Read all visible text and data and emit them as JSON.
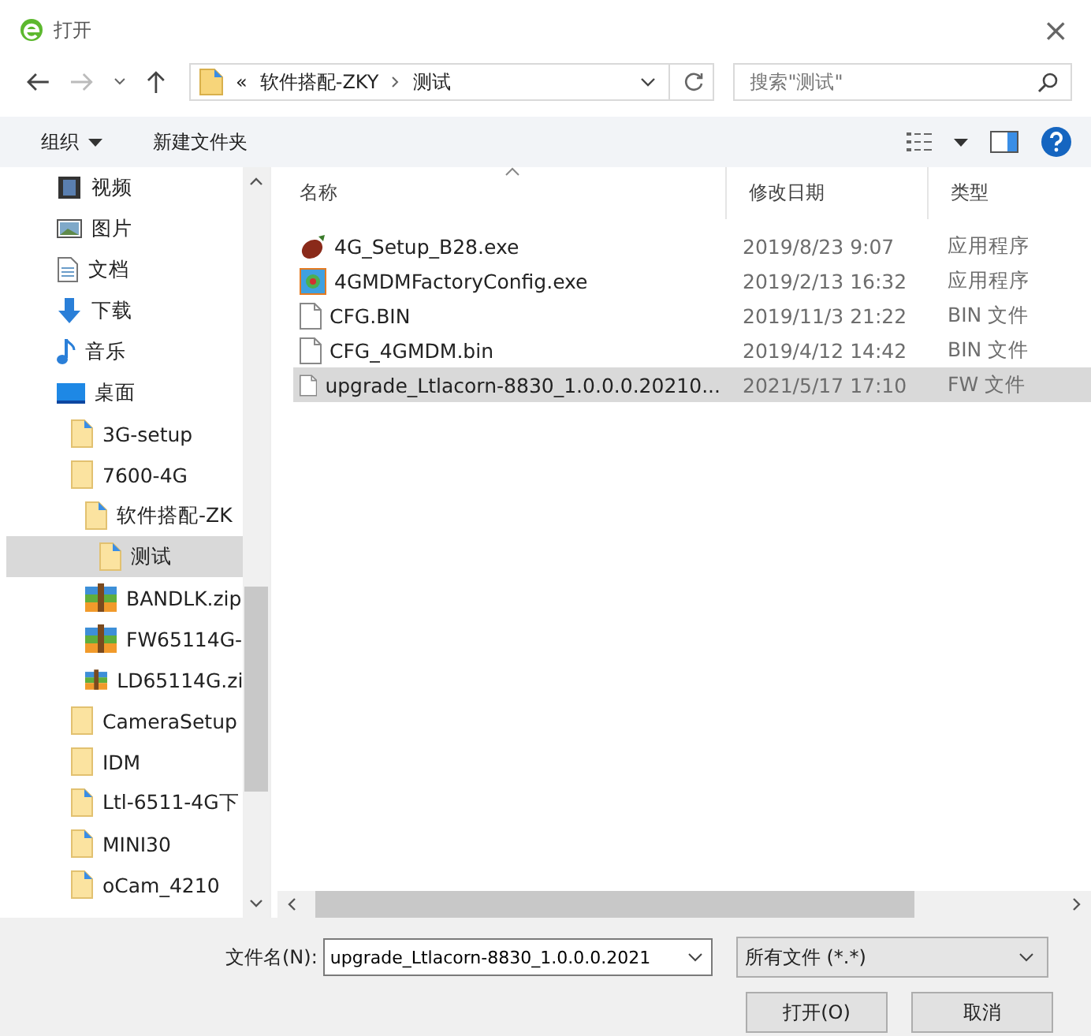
{
  "window": {
    "title": "打开",
    "close": "×"
  },
  "nav": {
    "path": [
      "软件搭配-ZKY",
      "测试"
    ],
    "overflow": "«",
    "search_placeholder": "搜索\"测试\""
  },
  "toolbar": {
    "organize": "组织",
    "new_folder": "新建文件夹"
  },
  "sidebar": {
    "items": [
      {
        "label": "视频",
        "kind": "video",
        "selected": false
      },
      {
        "label": "图片",
        "kind": "picture",
        "selected": false
      },
      {
        "label": "文档",
        "kind": "document",
        "selected": false
      },
      {
        "label": "下载",
        "kind": "download",
        "selected": false
      },
      {
        "label": "音乐",
        "kind": "music",
        "selected": false
      },
      {
        "label": "桌面",
        "kind": "desktop",
        "selected": false,
        "children": [
          {
            "label": "3G-setup",
            "kind": "shortcut",
            "selected": false
          },
          {
            "label": "7600-4G",
            "kind": "folder",
            "selected": false,
            "children": [
              {
                "label": "软件搭配-ZK",
                "kind": "shortcut",
                "selected": false,
                "children": [
                  {
                    "label": "测试",
                    "kind": "shortcut",
                    "selected": true
                  }
                ]
              },
              {
                "label": "BANDLK.zip",
                "kind": "zip",
                "selected": false
              },
              {
                "label": "FW65114G-",
                "kind": "zip",
                "selected": false
              },
              {
                "label": "LD65114G.zi",
                "kind": "zip",
                "selected": false
              }
            ]
          },
          {
            "label": "CameraSetup",
            "kind": "folder",
            "selected": false
          },
          {
            "label": "IDM",
            "kind": "folder",
            "selected": false
          },
          {
            "label": "Ltl-6511-4G下",
            "kind": "shortcut",
            "selected": false
          },
          {
            "label": "MINI30",
            "kind": "shortcut",
            "selected": false
          },
          {
            "label": "oCam_4210",
            "kind": "shortcut",
            "selected": false
          }
        ]
      }
    ]
  },
  "table": {
    "columns": [
      "名称",
      "修改日期",
      "类型"
    ],
    "rows": [
      {
        "name": "4G_Setup_B28.exe",
        "date": "2019/8/23 9:07",
        "type": "应用程序",
        "kind": "installer",
        "selected": false
      },
      {
        "name": "4GMDMFactoryConfig.exe",
        "date": "2019/2/13 16:32",
        "type": "应用程序",
        "kind": "app",
        "selected": false
      },
      {
        "name": "CFG.BIN",
        "date": "2019/11/3 21:22",
        "type": "BIN 文件",
        "kind": "file",
        "selected": false
      },
      {
        "name": "CFG_4GMDM.bin",
        "date": "2019/4/12 14:42",
        "type": "BIN 文件",
        "kind": "file",
        "selected": false
      },
      {
        "name": "upgrade_Ltlacorn-8830_1.0.0.0.20210...",
        "date": "2021/5/17 17:10",
        "type": "FW 文件",
        "kind": "file",
        "selected": true
      }
    ]
  },
  "footer": {
    "filename_label": "文件名(N):",
    "filename_value": "upgrade_Ltlacorn-8830_1.0.0.0.2021",
    "filter": "所有文件 (*.*)",
    "buttons": [
      "打开(O)",
      "取消"
    ]
  }
}
